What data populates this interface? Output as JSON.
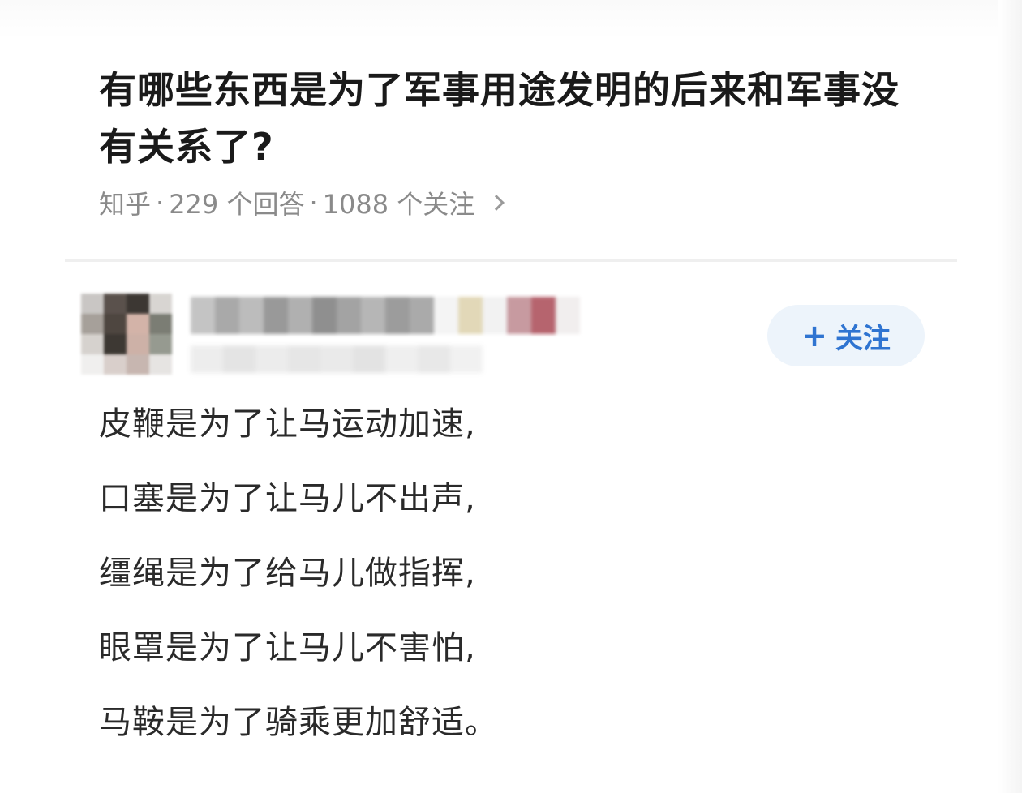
{
  "question": {
    "title": "有哪些东西是为了军事用途发明的后来和军事没有关系了?",
    "source": "知乎",
    "answers_count": "229 个回答",
    "followers_count": "1088 个关注",
    "separator": "·",
    "chevron_icon": "chevron-right-icon"
  },
  "author": {
    "name_blurred": true,
    "avatar_blurred": true,
    "follow_label": "关注",
    "follow_icon": "plus-icon"
  },
  "answer": {
    "lines": [
      "皮鞭是为了让马运动加速,",
      "口塞是为了让马儿不出声,",
      "缰绳是为了给马儿做指挥,",
      "眼罩是为了让马儿不害怕,",
      "马鞍是为了骑乘更加舒适。"
    ]
  },
  "colors": {
    "title": "#1a1a1a",
    "meta": "#8a8a8a",
    "follow_text": "#2f74d1",
    "follow_bg": "#edf4fb",
    "answer_text": "#2a2a2a"
  }
}
